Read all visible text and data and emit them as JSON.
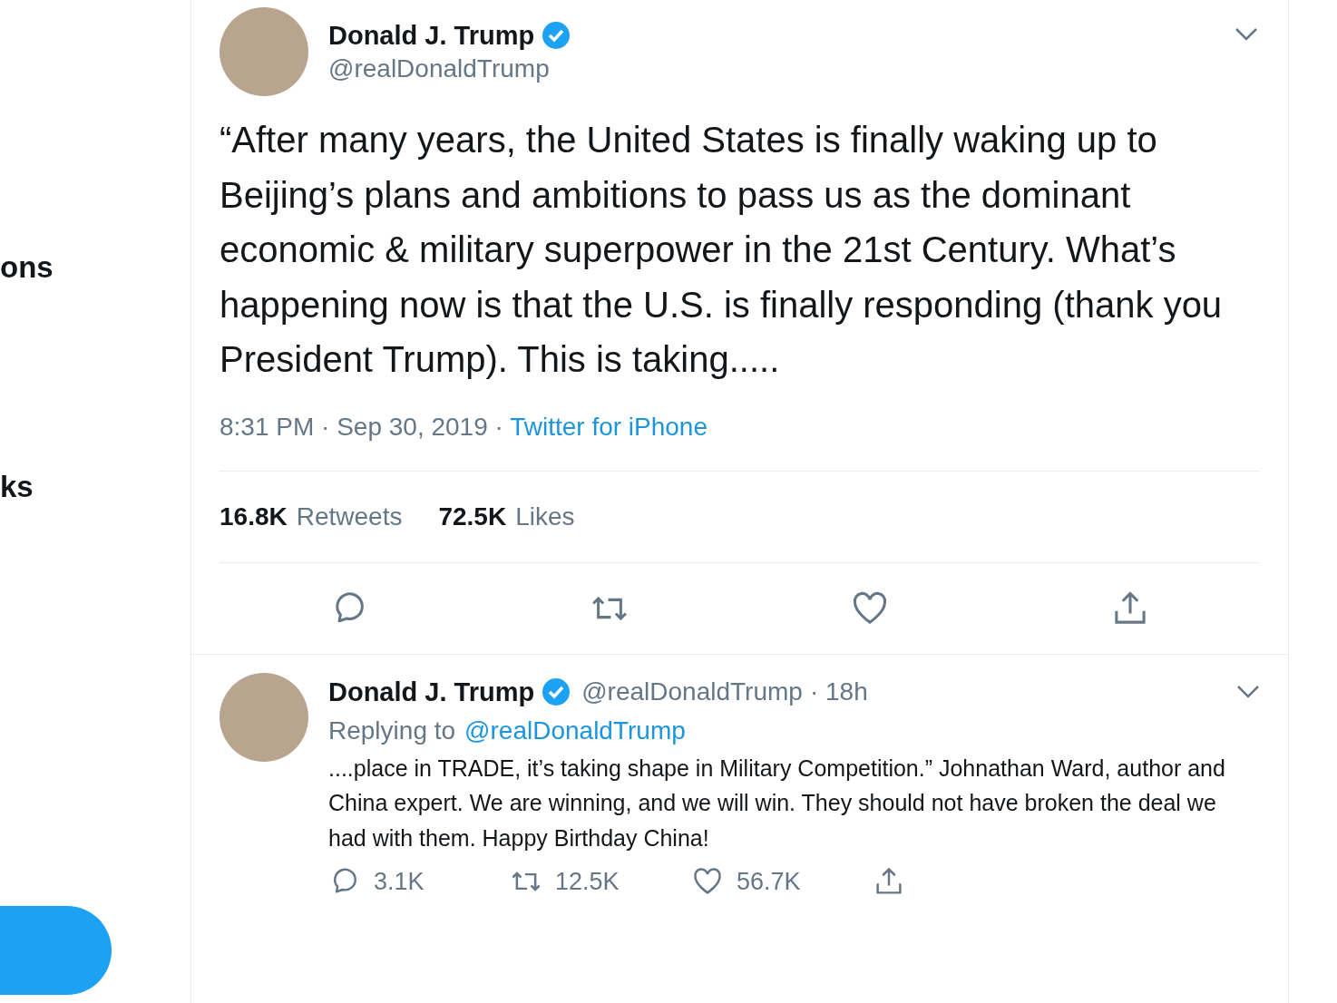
{
  "sidebar": {
    "items": [
      {
        "label": "ons"
      },
      {
        "label": "ks"
      }
    ]
  },
  "tweet": {
    "author": {
      "name": "Donald J. Trump",
      "verified": true,
      "handle": "@realDonaldTrump"
    },
    "text": "“After many years, the United States is finally waking up to Beijing’s plans and ambitions to pass us as the dominant economic & military superpower in the 21st Century. What’s happening now is that the U.S. is finally responding (thank you President Trump). This is taking.....",
    "time": "8:31 PM · Sep 30, 2019 · ",
    "source": "Twitter for iPhone",
    "stats": [
      {
        "count": "16.8K",
        "label": "Retweets"
      },
      {
        "count": "72.5K",
        "label": "Likes"
      }
    ],
    "actions": [
      {
        "kind": "reply"
      },
      {
        "kind": "retweet"
      },
      {
        "kind": "like"
      },
      {
        "kind": "share"
      }
    ]
  },
  "reply": {
    "author": {
      "name": "Donald J. Trump",
      "verified": true,
      "handle": "@realDonaldTrump"
    },
    "age": "· 18h",
    "replying_label": "Replying to",
    "replying_to": "@realDonaldTrump",
    "text": "....place in TRADE, it’s taking shape in Military Competition.” Johnathan Ward, author and China expert. We are winning, and we will win. They should not have broken the deal we had with them. Happy Birthday China!",
    "actions": [
      {
        "kind": "reply",
        "count": "3.1K"
      },
      {
        "kind": "retweet",
        "count": "12.5K"
      },
      {
        "kind": "like",
        "count": "56.7K"
      },
      {
        "kind": "share"
      }
    ]
  }
}
